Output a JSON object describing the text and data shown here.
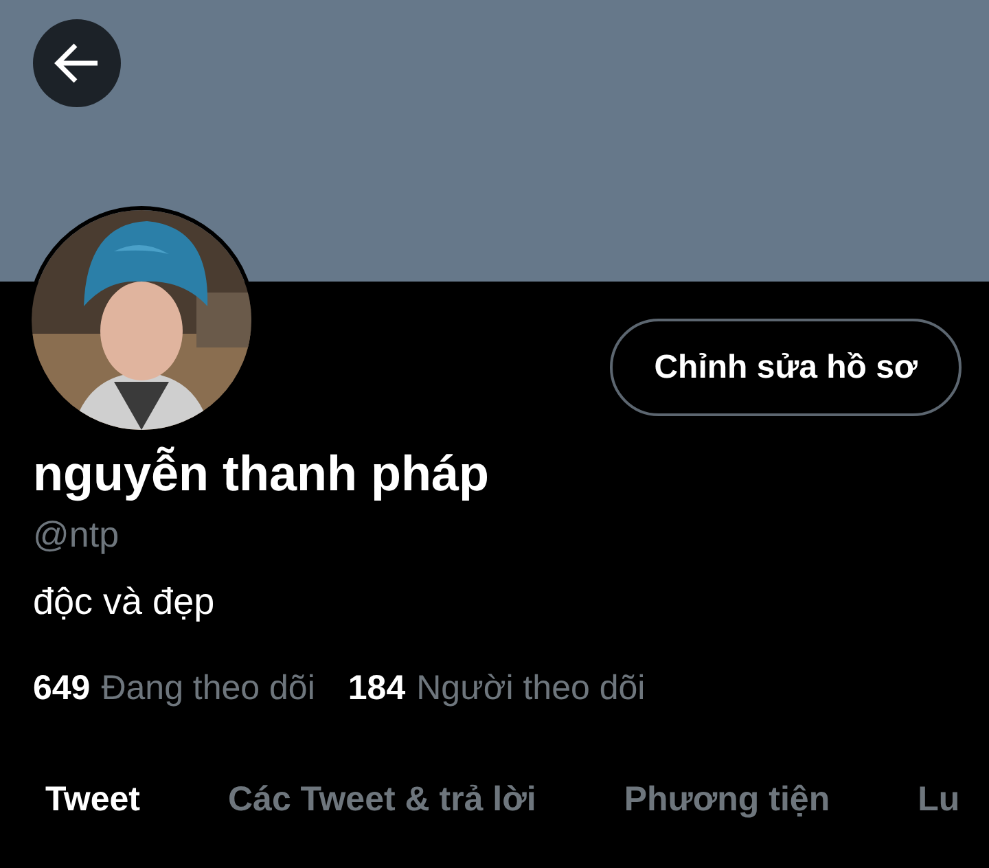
{
  "profile": {
    "name": "nguyễn thanh pháp",
    "handle": "@ntp",
    "bio": "độc và đẹp",
    "edit_button": "Chỉnh sửa hồ sơ"
  },
  "stats": [
    {
      "count": "649",
      "label": "Đang theo dõi"
    },
    {
      "count": "184",
      "label": "Người theo dõi"
    }
  ],
  "tabs": [
    {
      "label": "Tweet",
      "selected": true
    },
    {
      "label": "Các Tweet & trả lời",
      "selected": false
    },
    {
      "label": "Phương tiện",
      "selected": false
    },
    {
      "label": "Lu",
      "selected": false
    }
  ]
}
